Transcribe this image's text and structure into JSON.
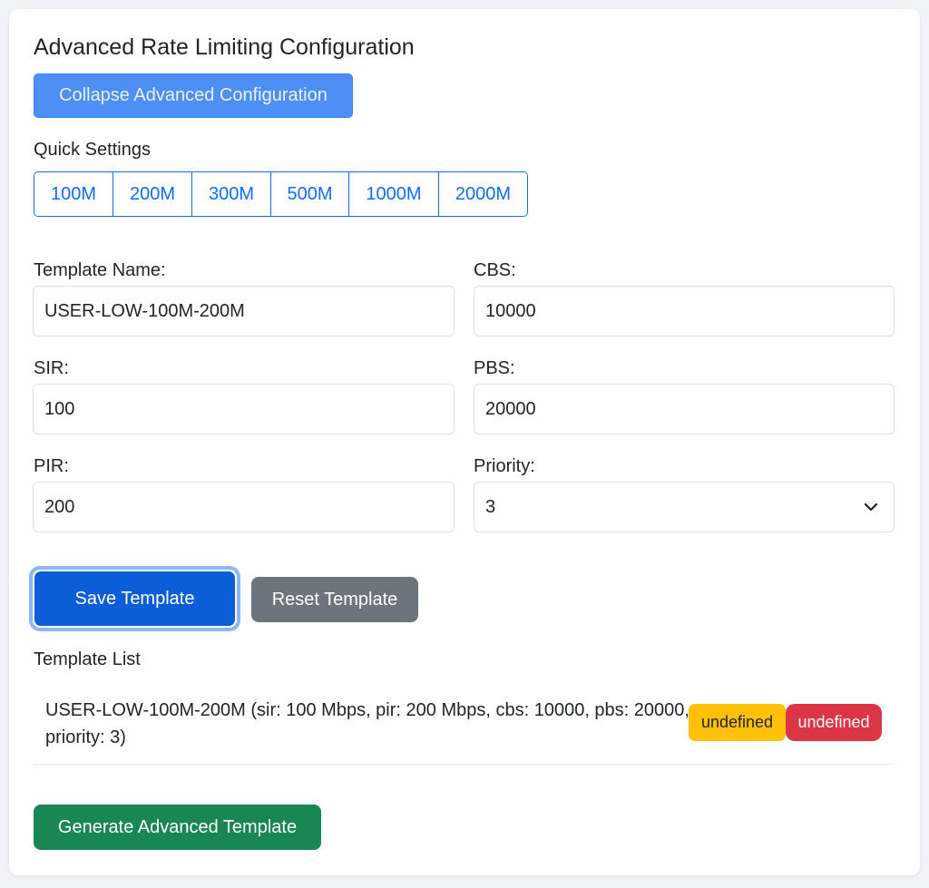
{
  "header": {
    "title": "Advanced Rate Limiting Configuration",
    "collapse_label": "Collapse Advanced Configuration"
  },
  "quick_settings": {
    "label": "Quick Settings",
    "options": [
      "100M",
      "200M",
      "300M",
      "500M",
      "1000M",
      "2000M"
    ]
  },
  "form": {
    "template_name": {
      "label": "Template Name:",
      "value": "USER-LOW-100M-200M"
    },
    "cbs": {
      "label": "CBS:",
      "value": "10000"
    },
    "sir": {
      "label": "SIR:",
      "value": "100"
    },
    "pbs": {
      "label": "PBS:",
      "value": "20000"
    },
    "pir": {
      "label": "PIR:",
      "value": "200"
    },
    "priority": {
      "label": "Priority:",
      "value": "3"
    }
  },
  "actions": {
    "save_label": "Save Template",
    "reset_label": "Reset Template",
    "generate_label": "Generate Advanced Template"
  },
  "template_list": {
    "label": "Template List",
    "items": [
      {
        "text": "USER-LOW-100M-200M (sir: 100 Mbps, pir: 200 Mbps, cbs: 10000, pbs: 20000, priority: 3)",
        "badge_warning": "undefined",
        "badge_danger": "undefined"
      }
    ]
  },
  "colors": {
    "primary": "#0d6efd",
    "success": "#198754",
    "secondary": "#6c757d",
    "warning": "#ffc107",
    "danger": "#dc3545"
  },
  "icons": {
    "priority_select": "chevron-down-icon"
  }
}
